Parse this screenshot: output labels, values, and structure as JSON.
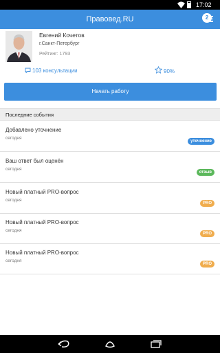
{
  "status_bar": {
    "time": "17:02"
  },
  "app_bar": {
    "title": "Правовед.RU",
    "notification_count": "2"
  },
  "profile": {
    "name": "Евгений Кочетов",
    "city": "г.Санкт-Петербург",
    "rating": "Рейтинг: 1793",
    "consultations": "103 консультации",
    "percent": "90%"
  },
  "start_button": {
    "label": "Начать работу"
  },
  "events_section": {
    "title": "Последние события"
  },
  "events": [
    {
      "title": "Добавлено уточнение",
      "date": "сегодня",
      "badge": "уточнение",
      "badge_color": "#3c8ede"
    },
    {
      "title": "Ваш ответ был оценён",
      "date": "сегодня",
      "badge": "отзыв",
      "badge_color": "#5cb85c"
    },
    {
      "title": "Новый платный PRO-вопрос",
      "date": "сегодня",
      "badge": "PRO",
      "badge_color": "#f0ad4e"
    },
    {
      "title": "Новый платный PRO-вопрос",
      "date": "сегодня",
      "badge": "PRO",
      "badge_color": "#f0ad4e"
    },
    {
      "title": "Новый платный PRO-вопрос",
      "date": "сегодня",
      "badge": "PRO",
      "badge_color": "#f0ad4e"
    }
  ],
  "icons": {
    "wifi": "wifi-icon",
    "battery": "battery-icon",
    "notifications": "notification-icon",
    "consultations": "chat-bubble-icon",
    "rating": "star-icon",
    "nav_back": "back-icon",
    "nav_home": "home-icon",
    "nav_recents": "recents-icon"
  },
  "colors": {
    "accent": "#3c8ede",
    "review": "#5cb85c",
    "pro": "#f0ad4e"
  }
}
